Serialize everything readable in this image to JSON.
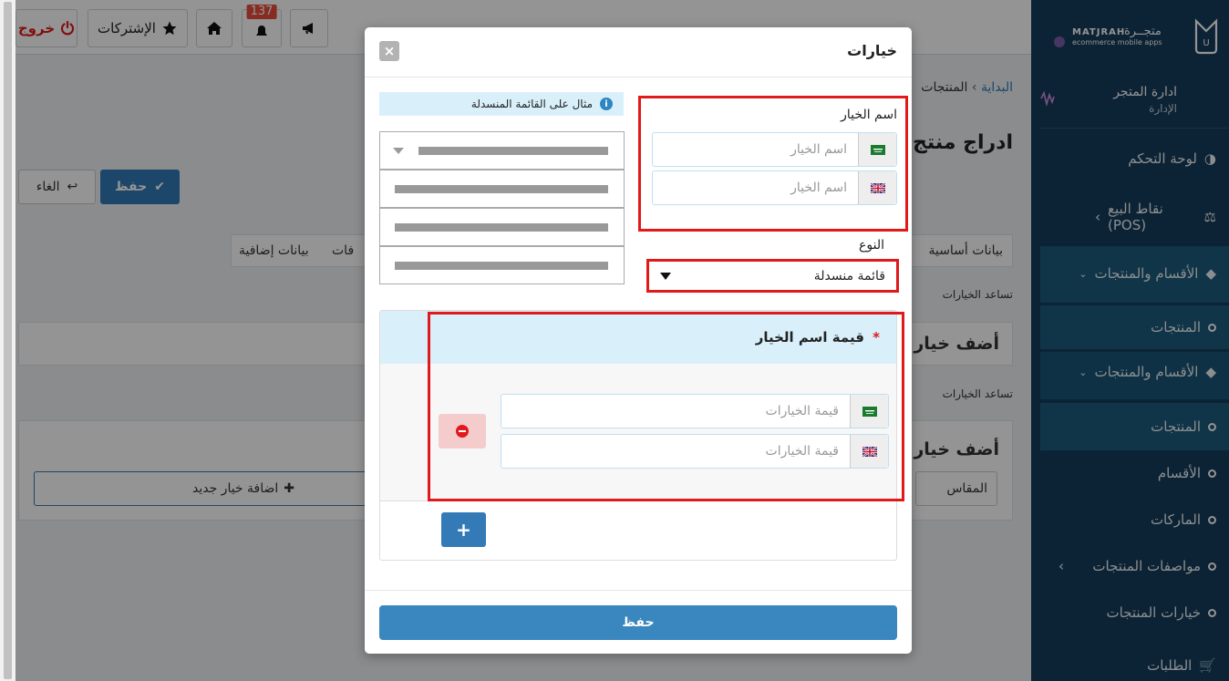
{
  "topbar": {
    "logout_label": "خروج",
    "subscriptions_label": "الإشتركات",
    "notifications_count": "137"
  },
  "sidebar": {
    "brand": "MATJRAH",
    "brand_sub": "ecommerce mobile apps",
    "brand_ar": "متجــرة",
    "store_admin": "ادارة المتجر",
    "admin_sub": "الإدارة",
    "items": [
      {
        "label": "لوحة التحكم"
      },
      {
        "label": "نقاط البيع (POS)"
      },
      {
        "label": "الأقسام والمنتجات"
      },
      {
        "label": "المنتجات"
      },
      {
        "label": "الأقسام والمنتجات"
      },
      {
        "label": "المنتجات"
      },
      {
        "label": "الأقسام"
      },
      {
        "label": "الماركات"
      },
      {
        "label": "مواصفات المنتجات"
      },
      {
        "label": "خيارات المنتجات"
      },
      {
        "label": "الطلبات"
      }
    ]
  },
  "background": {
    "breadcrumb_home": "البداية",
    "breadcrumb_products": "المنتجات",
    "page_title": "ادراج منتج",
    "save_label": "حفظ",
    "cancel_label": "الغاء",
    "tab_basic": "بيانات أساسية",
    "tab_specs": "فات",
    "tab_extra": "بيانات إضافية",
    "hint_text": "تساعد الخيارات",
    "section_title": "أضف خيار",
    "add_new_option": "اضافة خيار جديد",
    "size_label": "المقاس"
  },
  "modal": {
    "title": "خيارات",
    "close_label": "×",
    "option_name_label": "اسم الخيار",
    "option_name_ar_placeholder": "اسم الخيار",
    "option_name_en_placeholder": "اسم الخيار",
    "type_label": "النوع",
    "type_value": "قائمة منسدلة",
    "example_hint": "مثال على القائمة المنسدلة",
    "values_title": "قيمة اسم الخيار",
    "required_mark": "*",
    "value_ar_placeholder": "قيمة الخيارات",
    "value_en_placeholder": "قيمة الخيارات",
    "add_value_label": "+",
    "save_label": "حفظ"
  },
  "colors": {
    "primary": "#337ab7",
    "sidebar": "#163d5c",
    "highlight": "#e0191b",
    "info": "#d9f0fb"
  }
}
